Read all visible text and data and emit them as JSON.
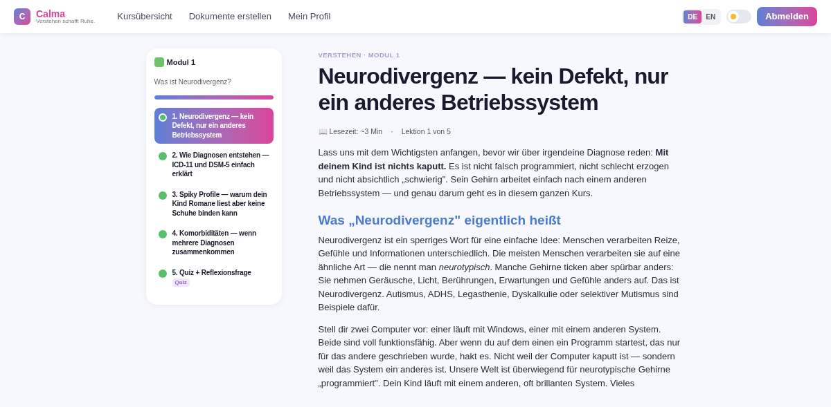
{
  "header": {
    "logo_letter": "C",
    "brand": "Calma",
    "tagline": "Verstehen schafft Ruhe.",
    "nav": [
      {
        "label": "Kursübersicht"
      },
      {
        "label": "Dokumente erstellen"
      },
      {
        "label": "Mein Profil"
      }
    ],
    "languages": [
      {
        "label": "DE",
        "selected": true
      },
      {
        "label": "EN",
        "selected": false
      }
    ],
    "theme_toggle": {
      "on": false
    },
    "logout": "Abmelden"
  },
  "sidebar": {
    "title": "Modul 1",
    "subtitle": "Was ist Neurodivergenz?",
    "progress": {
      "level": 1
    },
    "lessons": [
      {
        "title": "1. Neurodivergenz — kein Defekt, nur ein anderes Betriebssystem",
        "selected": true
      },
      {
        "title": "2. Wie Diagnosen entstehen — ICD-11 und DSM-5 einfach erklärt",
        "selected": false
      },
      {
        "title": "3. Spiky Profile — warum dein Kind Romane liest aber keine Schuhe binden kann",
        "selected": false
      },
      {
        "title": "4. Komorbiditäten — wenn mehrere Diagnosen zusammenkommen",
        "selected": false
      },
      {
        "title": "5. Quiz + Reflexionsfrage",
        "selected": false,
        "badge": "Quiz"
      }
    ]
  },
  "article": {
    "eyebrow": "VERSTEHEN · MODUL 1",
    "title": "Neurodivergenz — kein Defekt, nur ein anderes Betriebssystem",
    "reading_time": "📖 Lesezeit: ~3 Min",
    "separator": "·",
    "lesson_count": "Lektion 1 von 5",
    "blocks": [
      {
        "kind": "paragraph",
        "text": "Lass uns mit dem Wichtigsten anfangen, bevor wir über irgendeine Diagnose reden: **Mit deinem Kind ist nichts kaputt.** Es ist nicht falsch programmiert, nicht schlecht erzogen und nicht absichtlich „schwierig\". Sein Gehirn arbeitet einfach nach einem anderen Betriebssystem — und genau darum geht es in diesem ganzen Kurs."
      },
      {
        "kind": "heading",
        "text": "Was „Neurodivergenz\" eigentlich heißt"
      },
      {
        "kind": "paragraph",
        "text": "Neurodivergenz ist ein sperriges Wort für eine einfache Idee: Menschen verarbeiten Reize, Gefühle und Informationen unterschiedlich. Die meisten Menschen verarbeiten sie auf eine ähnliche Art — die nennt man *neurotypisch*. Manche Gehirne ticken aber spürbar anders: Sie nehmen Geräusche, Licht, Berührungen, Erwartungen und Gefühle anders auf. Das ist Neurodivergenz. Autismus, ADHS, Legasthenie, Dyskalkulie oder selektiver Mutismus sind Beispiele dafür."
      },
      {
        "kind": "paragraph",
        "text": "Stell dir zwei Computer vor: einer läuft mit Windows, einer mit einem anderen System. Beide sind voll funktionsfähig. Aber wenn du auf dem einen ein Programm startest, das nur für das andere geschrieben wurde, hakt es. Nicht weil der Computer kaputt ist — sondern weil das System ein anderes ist. Unsere Welt ist überwiegend für neurotypische Gehirne „programmiert\". Dein Kind läuft mit einem anderen, oft brillanten System. Vieles"
      }
    ]
  }
}
